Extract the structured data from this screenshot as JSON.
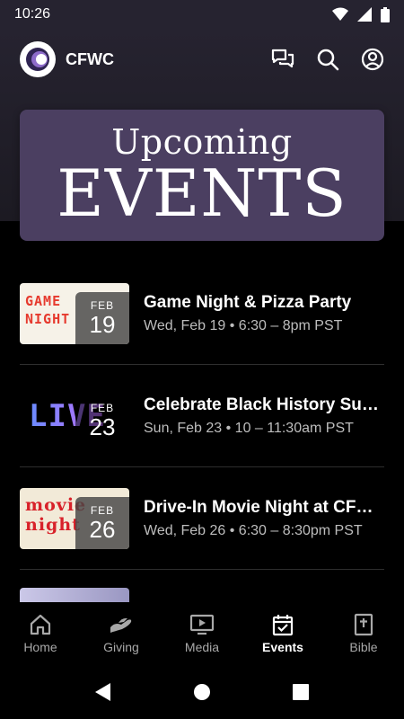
{
  "status_bar": {
    "time": "10:26"
  },
  "header": {
    "title": "CFWC"
  },
  "banner": {
    "line1": "Upcoming",
    "line2": "EVENTS"
  },
  "events": [
    {
      "thumb_text": "GAME NIGHT",
      "month": "FEB",
      "day": "19",
      "title": "Game Night & Pizza Party",
      "subtitle": "Wed, Feb 19 • 6:30 – 8pm PST"
    },
    {
      "thumb_text": "LIVE",
      "month": "FEB",
      "day": "23",
      "title": "Celebrate Black History Sun…",
      "subtitle": "Sun, Feb 23 • 10 – 11:30am PST"
    },
    {
      "thumb_text": "movie night",
      "month": "FEB",
      "day": "26",
      "title": "Drive-In Movie Night at CFWC",
      "subtitle": "Wed, Feb 26 • 6:30 – 8:30pm PST"
    }
  ],
  "nav": [
    {
      "label": "Home",
      "icon": "home-icon"
    },
    {
      "label": "Giving",
      "icon": "giving-hand-icon"
    },
    {
      "label": "Media",
      "icon": "media-play-icon"
    },
    {
      "label": "Events",
      "icon": "calendar-icon",
      "active": true
    },
    {
      "label": "Bible",
      "icon": "bible-icon"
    }
  ]
}
